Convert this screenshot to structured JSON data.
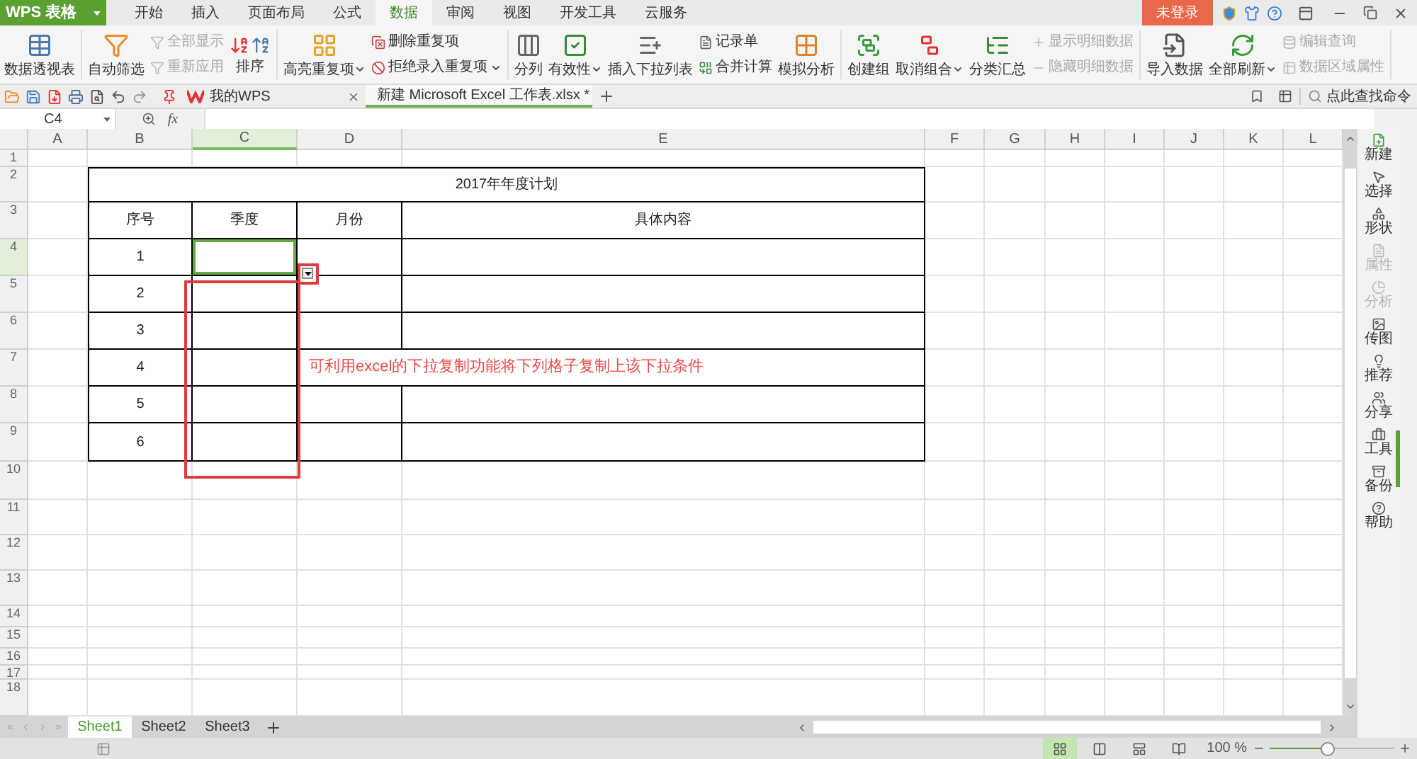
{
  "app": {
    "logo": "WPS 表格"
  },
  "menu_tabs": [
    {
      "label": "开始",
      "selected": false
    },
    {
      "label": "插入",
      "selected": false
    },
    {
      "label": "页面布局",
      "selected": false
    },
    {
      "label": "公式",
      "selected": false
    },
    {
      "label": "数据",
      "selected": true
    },
    {
      "label": "审阅",
      "selected": false
    },
    {
      "label": "视图",
      "selected": false
    },
    {
      "label": "开发工具",
      "selected": false
    },
    {
      "label": "云服务",
      "selected": false
    }
  ],
  "login": "未登录",
  "ribbon": [
    {
      "items": [
        {
          "kind": "large",
          "label": "数据透视表",
          "disabled": false,
          "dropdown": false
        }
      ]
    },
    {
      "items": [
        {
          "kind": "large",
          "label": "自动筛选",
          "disabled": false,
          "dropdown": false
        },
        {
          "kind": "pair",
          "items": [
            {
              "label": "全部显示",
              "disabled": true,
              "dropdown": false
            },
            {
              "label": "重新应用",
              "disabled": true,
              "dropdown": false
            }
          ]
        },
        {
          "kind": "sort",
          "label": "排序",
          "disabled": false,
          "dropdown": false
        }
      ]
    },
    {
      "items": [
        {
          "kind": "large",
          "label": "高亮重复项",
          "disabled": false,
          "dropdown": true
        },
        {
          "kind": "pair",
          "items": [
            {
              "label": "删除重复项",
              "disabled": false,
              "dropdown": false
            },
            {
              "label": "拒绝录入重复项",
              "disabled": false,
              "dropdown": true
            }
          ]
        }
      ]
    },
    {
      "items": [
        {
          "kind": "large",
          "label": "分列",
          "disabled": false,
          "dropdown": false
        },
        {
          "kind": "large",
          "label": "有效性",
          "disabled": false,
          "dropdown": true
        },
        {
          "kind": "large",
          "label": "插入下拉列表",
          "disabled": false,
          "dropdown": false
        },
        {
          "kind": "pair",
          "items": [
            {
              "label": "记录单",
              "disabled": false,
              "dropdown": false
            },
            {
              "label": "合并计算",
              "disabled": false,
              "dropdown": false
            }
          ]
        },
        {
          "kind": "large",
          "label": "模拟分析",
          "disabled": false,
          "dropdown": false
        }
      ]
    },
    {
      "items": [
        {
          "kind": "large",
          "label": "创建组",
          "disabled": false,
          "dropdown": false
        },
        {
          "kind": "large",
          "label": "取消组合",
          "disabled": false,
          "dropdown": true
        },
        {
          "kind": "large",
          "label": "分类汇总",
          "disabled": false,
          "dropdown": false
        },
        {
          "kind": "pair",
          "items": [
            {
              "label": "显示明细数据",
              "disabled": true,
              "dropdown": false
            },
            {
              "label": "隐藏明细数据",
              "disabled": true,
              "dropdown": false
            }
          ]
        }
      ]
    },
    {
      "items": [
        {
          "kind": "large",
          "label": "导入数据",
          "disabled": false,
          "dropdown": false
        },
        {
          "kind": "large",
          "label": "全部刷新",
          "disabled": false,
          "dropdown": true
        },
        {
          "kind": "pair",
          "items": [
            {
              "label": "编辑查询",
              "disabled": true,
              "dropdown": false
            },
            {
              "label": "数据区域属性",
              "disabled": true,
              "dropdown": false
            }
          ]
        }
      ]
    }
  ],
  "doc_tabs": [
    {
      "label": "我的WPS",
      "kind": "home",
      "selected": false
    },
    {
      "label": "新建 Microsoft Excel 工作表.xlsx *",
      "kind": "sheet",
      "selected": true
    }
  ],
  "search_command": "点此查找命令",
  "name_box": "C4",
  "fx": "fx",
  "grid": {
    "columns": [
      {
        "label": "A",
        "selected": false
      },
      {
        "label": "B",
        "selected": false
      },
      {
        "label": "C",
        "selected": true
      },
      {
        "label": "D",
        "selected": false
      },
      {
        "label": "E",
        "selected": false
      },
      {
        "label": "F",
        "selected": false
      },
      {
        "label": "G",
        "selected": false
      },
      {
        "label": "H",
        "selected": false
      },
      {
        "label": "I",
        "selected": false
      },
      {
        "label": "J",
        "selected": false
      },
      {
        "label": "K",
        "selected": false
      },
      {
        "label": "L",
        "selected": false
      }
    ],
    "rows": [
      {
        "label": "1",
        "selected": false
      },
      {
        "label": "2",
        "selected": false
      },
      {
        "label": "3",
        "selected": false
      },
      {
        "label": "4",
        "selected": true
      },
      {
        "label": "5",
        "selected": false
      },
      {
        "label": "6",
        "selected": false
      },
      {
        "label": "7",
        "selected": false
      },
      {
        "label": "8",
        "selected": false
      },
      {
        "label": "9",
        "selected": false
      },
      {
        "label": "10",
        "selected": false
      },
      {
        "label": "11",
        "selected": false
      },
      {
        "label": "12",
        "selected": false
      },
      {
        "label": "13",
        "selected": false
      },
      {
        "label": "14",
        "selected": false
      },
      {
        "label": "15",
        "selected": false
      },
      {
        "label": "16",
        "selected": false
      },
      {
        "label": "17",
        "selected": false
      },
      {
        "label": "18",
        "selected": false
      }
    ]
  },
  "plan_table": {
    "title": "2017年年度计划",
    "headers": [
      "序号",
      "季度",
      "月份",
      "具体内容"
    ],
    "rows": [
      [
        "1",
        "",
        "",
        ""
      ],
      [
        "2",
        "",
        "",
        ""
      ],
      [
        "3",
        "",
        "",
        ""
      ],
      [
        "4",
        "",
        "",
        ""
      ],
      [
        "5",
        "",
        "",
        ""
      ],
      [
        "6",
        "",
        "",
        ""
      ]
    ]
  },
  "annotation": "可利用excel的下拉复制功能将下列格子复制上该下拉条件",
  "sheet_tabs": [
    {
      "label": "Sheet1",
      "selected": true
    },
    {
      "label": "Sheet2",
      "selected": false
    },
    {
      "label": "Sheet3",
      "selected": false
    }
  ],
  "side_panel": [
    {
      "label": "新建",
      "disabled": false
    },
    {
      "label": "选择",
      "disabled": false
    },
    {
      "label": "形状",
      "disabled": false
    },
    {
      "label": "属性",
      "disabled": true
    },
    {
      "label": "分析",
      "disabled": true
    },
    {
      "label": "传图",
      "disabled": false
    },
    {
      "label": "推荐",
      "disabled": false
    },
    {
      "label": "分享",
      "disabled": false
    },
    {
      "label": "工具",
      "disabled": false
    },
    {
      "label": "备份",
      "disabled": false
    },
    {
      "label": "帮助",
      "disabled": false
    }
  ],
  "status": {
    "views": [
      {
        "kind": "normal",
        "selected": true
      },
      {
        "kind": "pagebreak",
        "selected": false
      },
      {
        "kind": "layout",
        "selected": false
      },
      {
        "kind": "reading",
        "selected": false
      }
    ],
    "zoom": "100 %",
    "level": 0.47
  }
}
